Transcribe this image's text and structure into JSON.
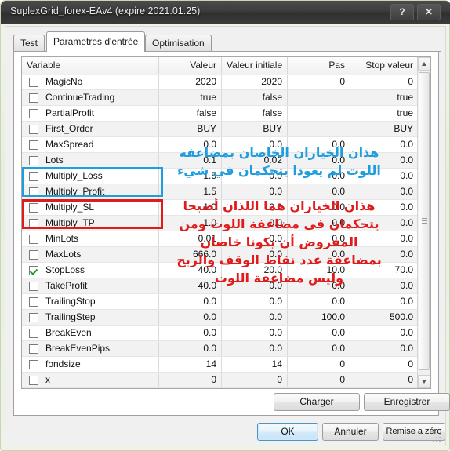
{
  "window": {
    "title": "SuplexGrid_forex-EAv4 (expire 2021.01.25)",
    "help_label": "?",
    "close_label": "✕"
  },
  "tabs": [
    {
      "label": "Test",
      "active": false
    },
    {
      "label": "Parametres d'entrée",
      "active": true
    },
    {
      "label": "Optimisation",
      "active": false
    }
  ],
  "grid": {
    "columns": [
      "Variable",
      "Valeur",
      "Valeur initiale",
      "Pas",
      "Stop valeur"
    ],
    "rows": [
      {
        "name": "MagicNo",
        "checked": false,
        "valeur": "2020",
        "initiale": "2020",
        "pas": "0",
        "stop": "0"
      },
      {
        "name": "ContinueTrading",
        "checked": false,
        "valeur": "true",
        "initiale": "false",
        "pas": "",
        "stop": "true"
      },
      {
        "name": "PartialProfit",
        "checked": false,
        "valeur": "false",
        "initiale": "false",
        "pas": "",
        "stop": "true"
      },
      {
        "name": "First_Order",
        "checked": false,
        "valeur": "BUY",
        "initiale": "BUY",
        "pas": "",
        "stop": "BUY"
      },
      {
        "name": "MaxSpread",
        "checked": false,
        "valeur": "0.0",
        "initiale": "0.0",
        "pas": "0.0",
        "stop": "0.0"
      },
      {
        "name": "Lots",
        "checked": false,
        "valeur": "0.1",
        "initiale": "0.02",
        "pas": "0.0",
        "stop": "0.0"
      },
      {
        "name": "Multiply_Loss",
        "checked": false,
        "valeur": "1.5",
        "initiale": "0.0",
        "pas": "0.0",
        "stop": "0.0"
      },
      {
        "name": "Multiply_Profit",
        "checked": false,
        "valeur": "1.5",
        "initiale": "0.0",
        "pas": "0.0",
        "stop": "0.0"
      },
      {
        "name": "Multiply_SL",
        "checked": false,
        "valeur": "1.0",
        "initiale": "0.0",
        "pas": "0.0",
        "stop": "0.0"
      },
      {
        "name": "Multiply_TP",
        "checked": false,
        "valeur": "1.0",
        "initiale": "0.0",
        "pas": "0.0",
        "stop": "0.0"
      },
      {
        "name": "MinLots",
        "checked": false,
        "valeur": "0.01",
        "initiale": "0.0",
        "pas": "0.0",
        "stop": "0.0"
      },
      {
        "name": "MaxLots",
        "checked": false,
        "valeur": "666.0",
        "initiale": "0.0",
        "pas": "0.0",
        "stop": "0.0"
      },
      {
        "name": "StopLoss",
        "checked": true,
        "valeur": "40.0",
        "initiale": "20.0",
        "pas": "10.0",
        "stop": "70.0"
      },
      {
        "name": "TakeProfit",
        "checked": false,
        "valeur": "40.0",
        "initiale": "0.0",
        "pas": "0.0",
        "stop": "0.0"
      },
      {
        "name": "TrailingStop",
        "checked": false,
        "valeur": "0.0",
        "initiale": "0.0",
        "pas": "0.0",
        "stop": "0.0"
      },
      {
        "name": "TrailingStep",
        "checked": false,
        "valeur": "0.0",
        "initiale": "0.0",
        "pas": "100.0",
        "stop": "500.0"
      },
      {
        "name": "BreakEven",
        "checked": false,
        "valeur": "0.0",
        "initiale": "0.0",
        "pas": "0.0",
        "stop": "0.0"
      },
      {
        "name": "BreakEvenPips",
        "checked": false,
        "valeur": "0.0",
        "initiale": "0.0",
        "pas": "0.0",
        "stop": "0.0"
      },
      {
        "name": "fondsize",
        "checked": false,
        "valeur": "14",
        "initiale": "14",
        "pas": "0",
        "stop": "0"
      },
      {
        "name": "x",
        "checked": false,
        "valeur": "0",
        "initiale": "0",
        "pas": "0",
        "stop": "0"
      }
    ]
  },
  "panel_buttons": {
    "charger": "Charger",
    "enregistrer": "Enregistrer"
  },
  "footer_buttons": {
    "ok": "OK",
    "annuler": "Annuler",
    "reset": "Remise a zéro"
  },
  "annotations": {
    "blue": {
      "color": "#1f9ede",
      "lines": [
        "هذان الخياران الخاصان بمضاعفة",
        "اللوت لم يعودا يتحكمان في شيء"
      ]
    },
    "red": {
      "color": "#e01b1b",
      "lines": [
        "هذان الخياران هما اللذان أصبحا",
        "يتحكمان في مضاعفة اللوت ومن",
        "المفروض أن يكونا خاصان",
        "بمضاعفة عدد نقاط الوقف والربح",
        "وليس مضاعفة اللوت"
      ]
    }
  }
}
